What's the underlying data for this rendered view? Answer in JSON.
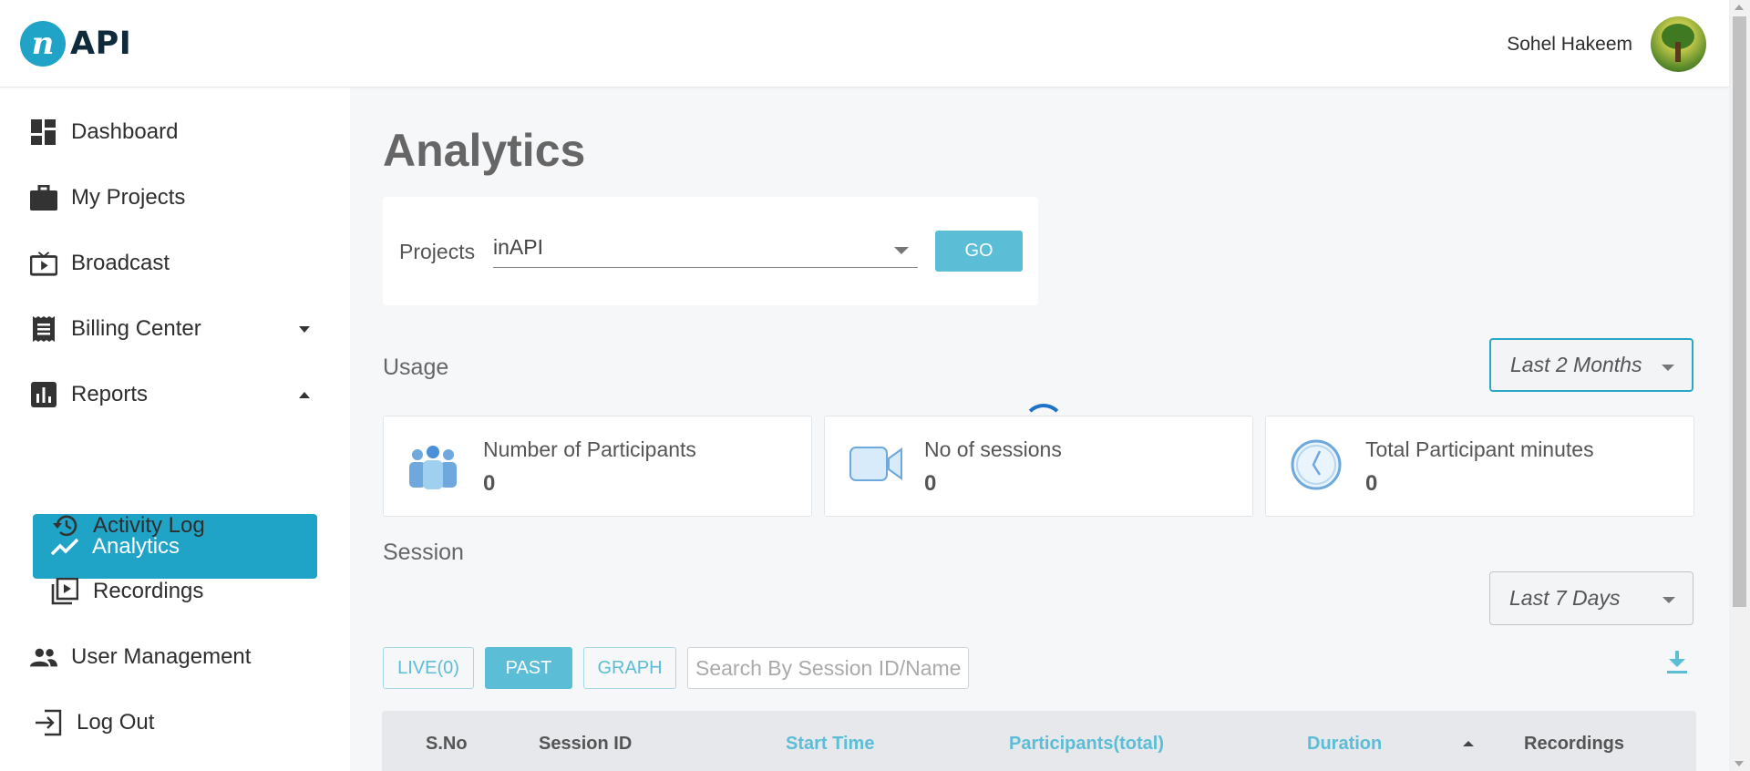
{
  "app": {
    "logo_letter": "n",
    "logo_text": "API",
    "accent": "#1fa3c6"
  },
  "user": {
    "name": "Sohel Hakeem"
  },
  "sidebar": {
    "items": [
      {
        "label": "Dashboard",
        "icon": "dashboard-icon"
      },
      {
        "label": "My Projects",
        "icon": "briefcase-icon"
      },
      {
        "label": "Broadcast",
        "icon": "tv-icon"
      },
      {
        "label": "Billing Center",
        "icon": "receipt-icon"
      },
      {
        "label": "Reports",
        "icon": "bar-chart-icon"
      },
      {
        "label": "Analytics",
        "icon": "trending-icon"
      },
      {
        "label": "Activity Log",
        "icon": "history-icon"
      },
      {
        "label": "Recordings",
        "icon": "video-library-icon"
      },
      {
        "label": "User Management",
        "icon": "people-icon"
      },
      {
        "label": "Log Out",
        "icon": "logout-icon"
      }
    ]
  },
  "main": {
    "title": "Analytics",
    "projects_label": "Projects",
    "project_value": "inAPI",
    "go_label": "GO",
    "usage_label": "Usage",
    "usage_range": "Last 2 Months",
    "stats": [
      {
        "title": "Number of Participants",
        "value": "0",
        "icon": "participants-icon"
      },
      {
        "title": "No of sessions",
        "value": "0",
        "icon": "video-camera-icon"
      },
      {
        "title": "Total Participant minutes",
        "value": "0",
        "icon": "clock-icon"
      }
    ],
    "session_label": "Session",
    "session_range": "Last 7 Days",
    "tabs": [
      "LIVE(0)",
      "PAST",
      "GRAPH"
    ],
    "search_placeholder": "Search By Session ID/Name",
    "table_headers": [
      "S.No",
      "Session ID",
      "Start Time",
      "Participants(total)",
      "Duration",
      "Recordings"
    ]
  }
}
